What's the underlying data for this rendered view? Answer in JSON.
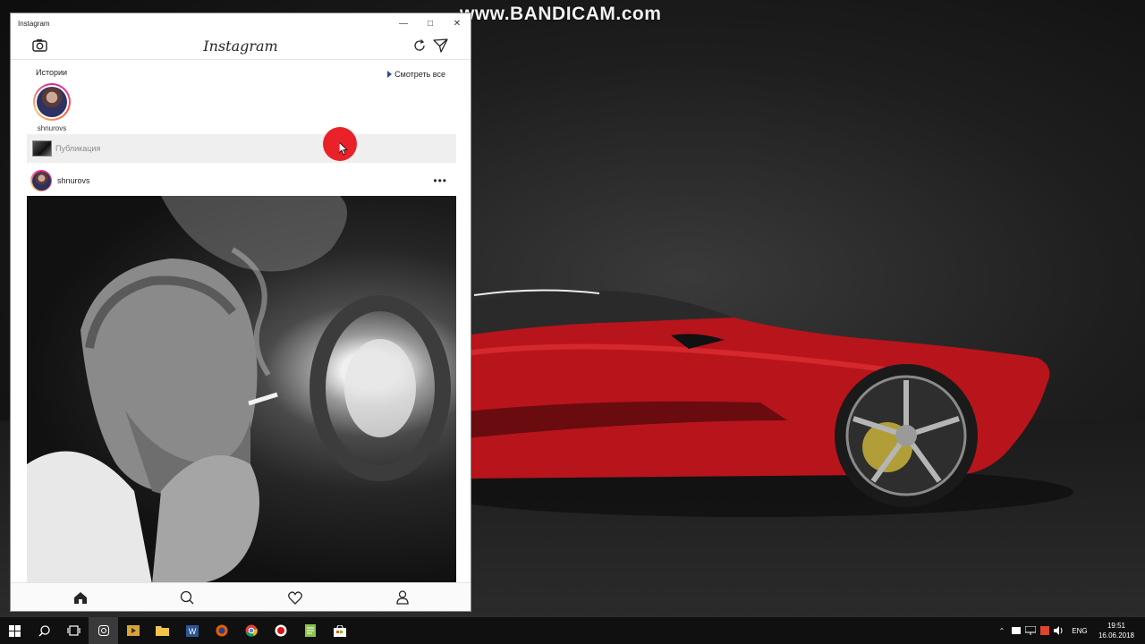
{
  "watermark": "www.BANDICAM.com",
  "window": {
    "title": "Instagram",
    "controls": [
      "minimize-icon",
      "maximize-icon",
      "close-icon"
    ]
  },
  "app": {
    "logo": "Instagram",
    "stories_heading": "Истории",
    "see_all_label": "Смотреть все",
    "stories": [
      {
        "username": "shnurovs"
      }
    ],
    "publication_label": "Публикация",
    "post": {
      "username": "shnurovs",
      "more_icon": "more-dots-icon"
    },
    "nav": [
      "home-icon",
      "search-icon",
      "heart-icon",
      "profile-icon"
    ]
  },
  "taskbar": {
    "apps": [
      "start-icon",
      "search-icon",
      "task-view-icon",
      "instagram-icon",
      "media-player-icon",
      "explorer-icon",
      "word-icon",
      "firefox-icon",
      "chrome-icon",
      "bandicam-icon",
      "notepad-icon",
      "store-icon"
    ],
    "language": "ENG",
    "time": "19:51",
    "date": "16.06.2018"
  },
  "colors": {
    "accent": "#2a4f8e",
    "record": "#e8161d",
    "taskbar": "#101010"
  }
}
